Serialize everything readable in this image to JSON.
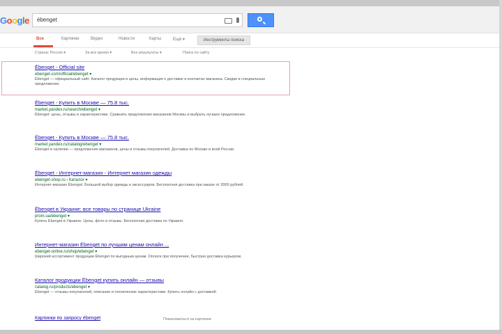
{
  "search": {
    "query": "ébenget"
  },
  "logo": {
    "letters": [
      {
        "ch": "G",
        "color": "#4285f4"
      },
      {
        "ch": "o",
        "color": "#ea4335"
      },
      {
        "ch": "o",
        "color": "#fbbc05"
      },
      {
        "ch": "g",
        "color": "#4285f4"
      },
      {
        "ch": "l",
        "color": "#34a853"
      },
      {
        "ch": "e",
        "color": "#ea4335"
      }
    ]
  },
  "tabs": [
    "Все",
    "Картинки",
    "Видео",
    "Новости",
    "Карты",
    "Ещё ▾"
  ],
  "tools_label": "Инструменты поиска",
  "filters": [
    "Страна: Россия ▾",
    "За все время ▾",
    "Все результаты ▾",
    "Поиск по сайту"
  ],
  "results": [
    {
      "title": "Ébenget - Official site",
      "url": "ebenget.com/official/ebenget ▾",
      "snippet": "Ébenget — официальный сайт. Каталог продукции и цены, информация о доставке и контактах магазина. Скидки и специальные предложения."
    },
    {
      "title": "Ébenget - Купить в Москве — 75.8 тыс.",
      "url": "market.yandex.ru/search/ebenget ▾",
      "snippet": "Ébenget: цены, отзывы и характеристики. Сравнить предложения магазинов Москвы и выбрать лучшее предложение."
    },
    {
      "title": "Ébenget - Купить в Москве — 75.8 тыс.",
      "url": "market.yandex.ru/catalog/ebenget ▾",
      "snippet": "Ébenget в наличии — предложения магазинов, цены и отзывы покупателей. Доставка по Москве и всей России."
    },
    {
      "title": "Ébenget - Интернет-магазин - Интернет магазин одежды",
      "url": "ebenget-shop.ru › Каталог ▾",
      "snippet": "Интернет-магазин Ébenget. Большой выбор одежды и аксессуаров. Бесплатная доставка при заказе от 3000 рублей."
    },
    {
      "title": "Ébenget в Украине: все товары по странице Ukraine",
      "url": "prom.ua/ebenget ▾",
      "snippet": "Купить Ébenget в Украине. Цены, фото и отзывы. Бесплатная доставка по Украине."
    },
    {
      "title": "Интернет-магазин Ébenget по лучшим ценам онлайн ...",
      "url": "ebenget-online.ru/shop/ebenget ▾",
      "snippet": "Широкий ассортимент продукции Ébenget по выгодным ценам. Оплата при получении, быстрая доставка курьером."
    },
    {
      "title": "Каталог продукции Ébenget купить онлайн — отзывы",
      "url": "catalog.ru/products/ebenget ▾",
      "snippet": "Ébenget — отзывы покупателей, описание и технические характеристики. Купить онлайн с доставкой."
    }
  ],
  "footer": {
    "link": "Картинки по запросу ébenget",
    "note": "Пожаловаться на картинки"
  }
}
